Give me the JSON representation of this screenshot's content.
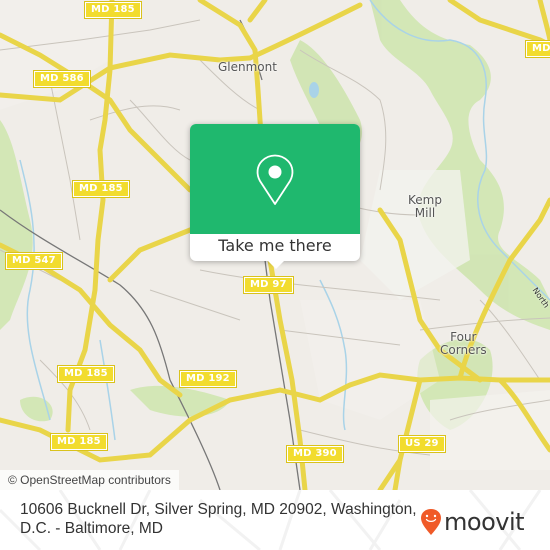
{
  "map": {
    "route_shields": [
      {
        "label": "MD 185"
      },
      {
        "label": "MD 586"
      },
      {
        "label": "MD 185"
      },
      {
        "label": "MD 547"
      },
      {
        "label": "MD 97"
      },
      {
        "label": "MD 185"
      },
      {
        "label": "MD 192"
      },
      {
        "label": "MD 185"
      },
      {
        "label": "MD 390"
      },
      {
        "label": "US 29"
      },
      {
        "label": "MD"
      }
    ],
    "places": [
      {
        "label": "Glenmont"
      },
      {
        "label": "Kemp\nMill"
      },
      {
        "label": "Four\nCorners"
      }
    ],
    "road_labels": [
      {
        "label": "North"
      }
    ],
    "attribution": "© OpenStreetMap contributors"
  },
  "popup": {
    "icon": "location-pin-icon",
    "button_label": "Take me there",
    "color": "#1fb86e"
  },
  "footer": {
    "address": "10606 Bucknell Dr, Silver Spring, MD 20902, Washington, D.C. - Baltimore, MD",
    "brand": "moovit",
    "brand_color": "#f05a28"
  }
}
